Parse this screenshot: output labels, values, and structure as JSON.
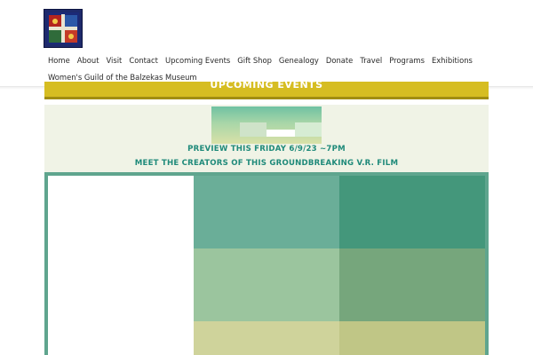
{
  "header": {
    "logo": {
      "name": "balzekas-museum-stained-glass-logo"
    },
    "nav": {
      "row1": [
        "Home",
        "About",
        "Visit",
        "Contact",
        "Upcoming Events",
        "Gift Shop",
        "Genealogy",
        "Donate",
        "Travel",
        "Programs",
        "Exhibitions"
      ],
      "row2": [
        "Women's Guild of the Balzekas Museum"
      ]
    }
  },
  "banner": {
    "title": "UPCOMING EVENTS",
    "color": "#d6bd22"
  },
  "event": {
    "line1": "PREVIEW THIS FRIDAY 6/9/23 ~7PM",
    "line2": "MEET THE CREATORS OF THIS GROUNDBREAKING V.R. FILM",
    "text_color": "#1f8a7a"
  },
  "palette": {
    "frame": "#5fa58e",
    "row1": [
      "#6aae98",
      "#44977b"
    ],
    "row2": [
      "#9bc59e",
      "#76a67c"
    ],
    "row3": [
      "#cfd39b",
      "#c0c686"
    ]
  }
}
